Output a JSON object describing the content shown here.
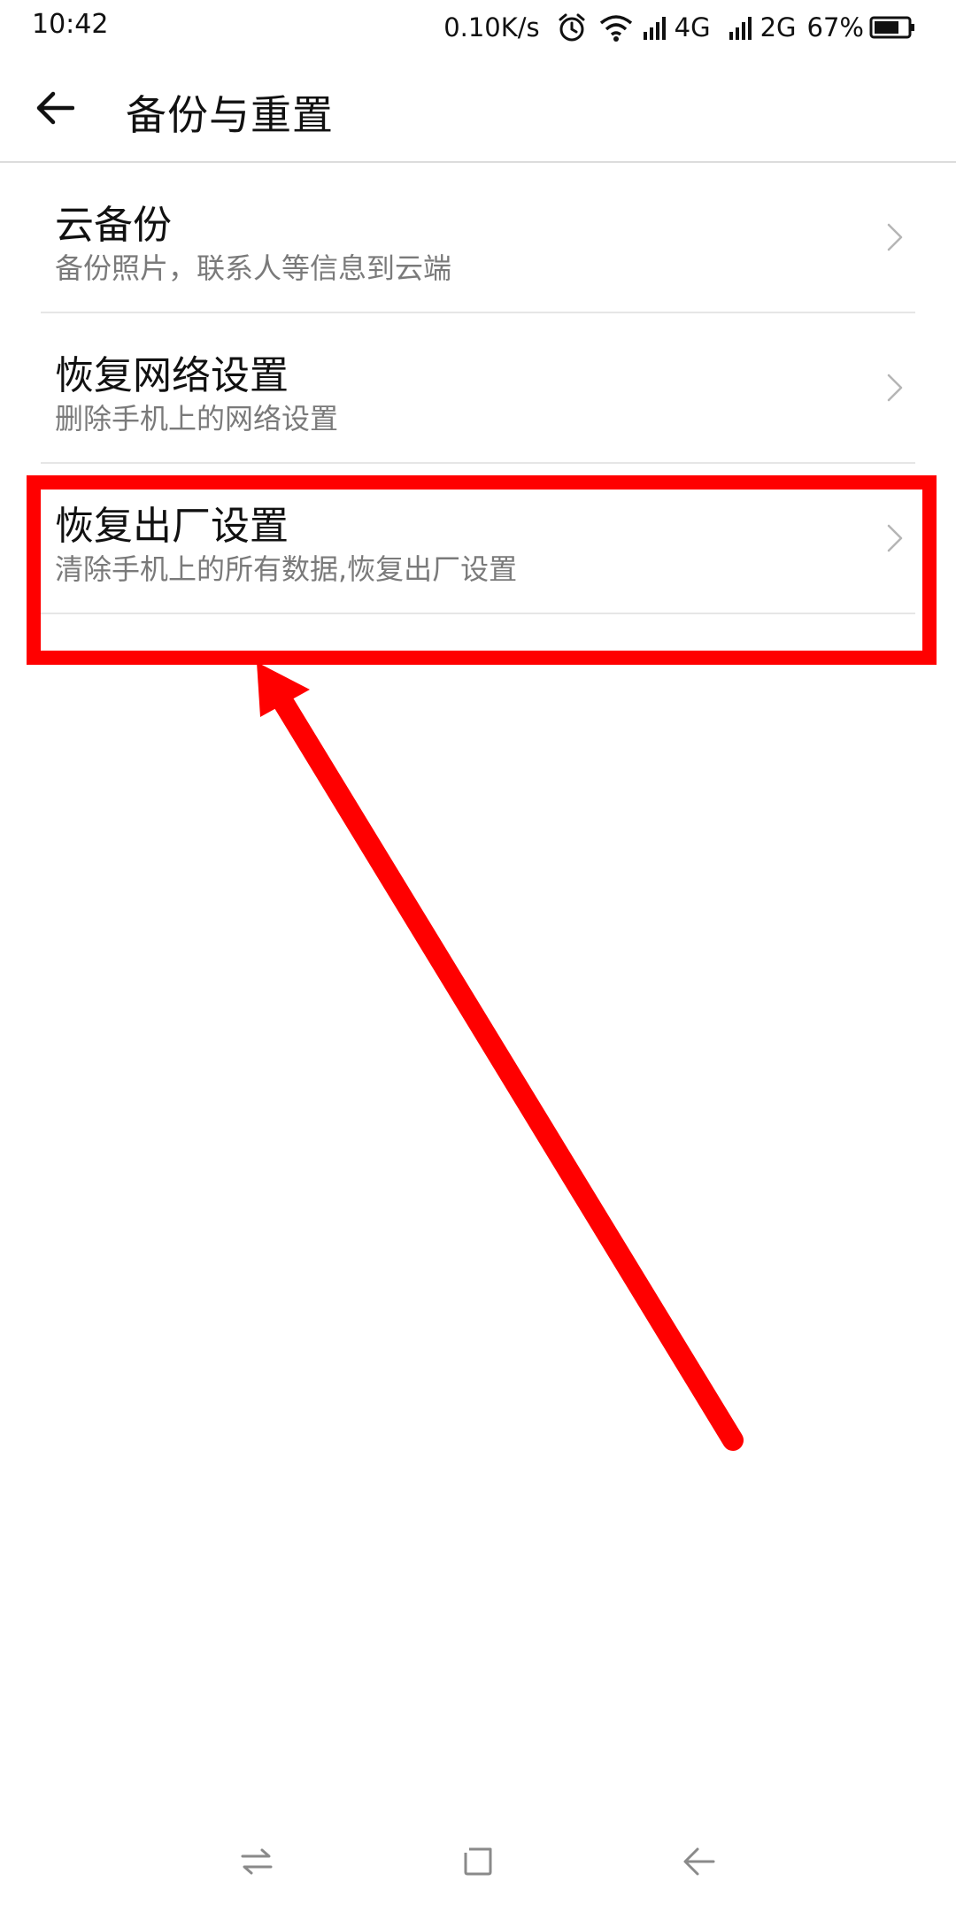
{
  "status_bar": {
    "time": "10:42",
    "speed": "0.10K/s",
    "net1": "4G",
    "net2": "2G",
    "battery": "67%",
    "icons": [
      "alarm-icon",
      "wifi-icon",
      "signal-icon",
      "battery-icon"
    ]
  },
  "header": {
    "title": "备份与重置",
    "back_icon": "arrow-left-icon"
  },
  "list": {
    "items": [
      {
        "title": "云备份",
        "desc": "备份照片，联系人等信息到云端"
      },
      {
        "title": "恢复网络设置",
        "desc": "删除手机上的网络设置"
      },
      {
        "title": "恢复出厂设置",
        "desc": "清除手机上的所有数据,恢复出厂设置"
      }
    ]
  },
  "annotation": {
    "color": "#ff0000"
  },
  "nav_bar": {
    "icons": [
      "switch-apps-icon",
      "home-icon",
      "back-icon"
    ]
  }
}
